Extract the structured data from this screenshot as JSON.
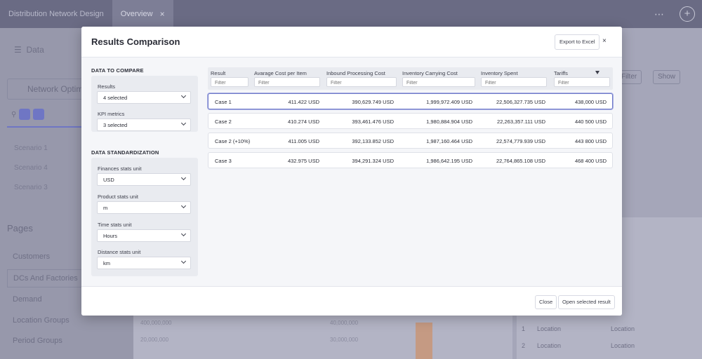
{
  "background": {
    "tabs": [
      {
        "label": "Distribution Network Design"
      },
      {
        "label": "Overview"
      }
    ],
    "top_right": {
      "more": "⋯"
    },
    "sidebar": {
      "data_label": "Data",
      "network_opt": "Network Optimi...",
      "scenarios": [
        "Scenario 1",
        "Scenario 4",
        "Scenario 3"
      ],
      "pages_title": "Pages",
      "pages": [
        "Customers",
        "DCs And Factories",
        "Demand",
        "Location Groups",
        "Period Groups"
      ]
    },
    "toolbar_buttons": [
      "Filter",
      "Show"
    ],
    "numbers": [
      "400,000,000",
      "20,000,000",
      "40,000,000",
      "30,000,000"
    ],
    "list_items": [
      {
        "num": "1",
        "a": "Location",
        "b": "Location"
      },
      {
        "num": "2",
        "a": "Location",
        "b": "Location"
      }
    ]
  },
  "modal": {
    "title": "Results Comparison",
    "export_label": "Export to Excel",
    "close_symbol": "×",
    "data_to_compare": {
      "title": "DATA TO COMPARE",
      "results_label": "Results",
      "results_value": "4 selected",
      "kpi_label": "KPI metrics",
      "kpi_value": "3 selected"
    },
    "standardization": {
      "title": "DATA STANDARDIZATION",
      "finances_label": "Finances stats unit",
      "finances_value": "USD",
      "product_label": "Product stats unit",
      "product_value": "m",
      "time_label": "Time stats unit",
      "time_value": "Hours",
      "distance_label": "Distance stats unit",
      "distance_value": "km"
    },
    "table": {
      "columns": [
        "Result",
        "Avarage Cost per Item",
        "Inbound Processing Cost",
        "Inventory Carrying Cost",
        "Inventory Spent",
        "Tariffs"
      ],
      "filter_placeholder": "Filter",
      "rows": [
        [
          "Case 1",
          "411.422 USD",
          "390,629.749 USD",
          "1,999,972.409 USD",
          "22,506,327.735 USD",
          "438,000 USD"
        ],
        [
          "Case 2",
          "410.274 USD",
          "393,461.476 USD",
          "1,980,884.904 USD",
          "22,263,357.111 USD",
          "440 500 USD"
        ],
        [
          "Case 2 (+10%)",
          "411.005 USD",
          "392,133.852 USD",
          "1,987,160.464 USD",
          "22,574,779.939 USD",
          "443 800 USD"
        ],
        [
          "Case 3",
          "432.975 USD",
          "394,291.324 USD",
          "1,986,642.195 USD",
          "22,764,865.108 USD",
          "468 400 USD"
        ]
      ]
    },
    "footer": {
      "close_label": "Close",
      "open_label": "Open selected result"
    }
  }
}
